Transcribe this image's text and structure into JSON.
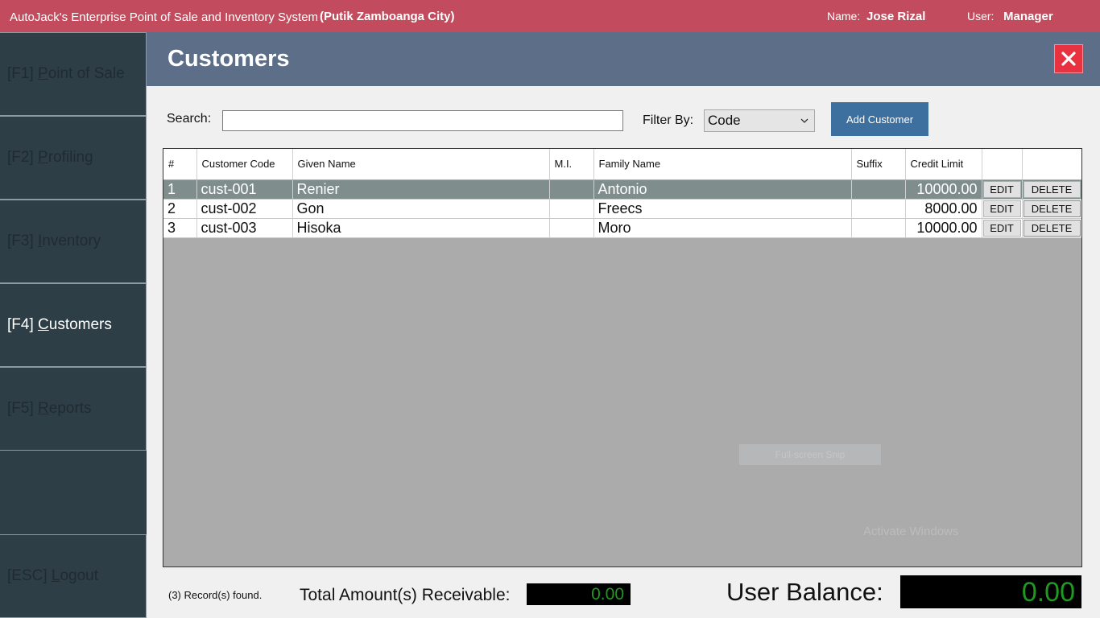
{
  "titlebar": {
    "app_title": "AutoJack's Enterprise Point of Sale and Inventory System",
    "branch": "(Putik Zamboanga City)",
    "name_label": "Name:",
    "name_value": "Jose Rizal",
    "user_label": "User:",
    "user_value": "Manager"
  },
  "sidebar": {
    "items": [
      {
        "key": "[F1]",
        "hotkey_letter": "P",
        "rest": "oint of Sale"
      },
      {
        "key": "[F2]",
        "hotkey_letter": "P",
        "rest": "rofiling"
      },
      {
        "key": "[F3]",
        "hotkey_letter": "I",
        "rest": "nventory"
      },
      {
        "key": "[F4]",
        "hotkey_letter": "C",
        "rest": "ustomers"
      },
      {
        "key": "[F5]",
        "hotkey_letter": "R",
        "rest": "eports"
      },
      {
        "key": "[ESC]",
        "hotkey_letter": "L",
        "rest": "ogout"
      }
    ],
    "active_index": 3
  },
  "header": {
    "title": "Customers",
    "close_icon": "close-icon"
  },
  "toolbar": {
    "search_label": "Search:",
    "search_value": "",
    "filter_label": "Filter By:",
    "filter_selected": "Code",
    "add_button": "Add Customer"
  },
  "table": {
    "columns": [
      "#",
      "Customer Code",
      "Given Name",
      "M.I.",
      "Family Name",
      "Suffix",
      "Credit Limit",
      "",
      ""
    ],
    "rows": [
      {
        "no": "1",
        "code": "cust-001",
        "given": "Renier",
        "mi": "",
        "family": "Antonio",
        "suffix": "",
        "credit": "10000.00",
        "edit": "EDIT",
        "delete": "DELETE"
      },
      {
        "no": "2",
        "code": "cust-002",
        "given": "Gon",
        "mi": "",
        "family": "Freecs",
        "suffix": "",
        "credit": "8000.00",
        "edit": "EDIT",
        "delete": "DELETE"
      },
      {
        "no": "3",
        "code": "cust-003",
        "given": "Hisoka",
        "mi": "",
        "family": "Moro",
        "suffix": "",
        "credit": "10000.00",
        "edit": "EDIT",
        "delete": "DELETE"
      }
    ],
    "selected_row": 0
  },
  "overlay": {
    "snip_label": "Full-screen Snip",
    "activate_text": "Activate Windows"
  },
  "footer": {
    "records": "(3) Record(s) found.",
    "total_label": "Total Amount(s) Receivable:",
    "total_value": "0.00",
    "balance_label": "User Balance:",
    "balance_value": "0.00"
  },
  "colors": {
    "titlebar": "#c24c5e",
    "sidebar": "#2e3e47",
    "header": "#5d6e88",
    "accent_button": "#3d709e",
    "close_button": "#e8323f",
    "balance_text": "#1f9a1f"
  }
}
